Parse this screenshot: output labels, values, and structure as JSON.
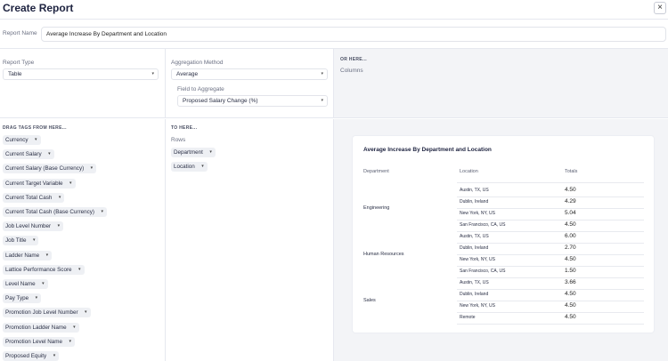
{
  "header": {
    "title": "Create Report",
    "close_icon": "×"
  },
  "report_name": {
    "label": "Report Name",
    "value": "Average Increase By Department and Location"
  },
  "report_type": {
    "label": "Report Type",
    "value": "Table"
  },
  "aggregation": {
    "label": "Aggregation Method",
    "value": "Average",
    "field_label": "Field to Aggregate",
    "field_value": "Proposed Salary Change (%)"
  },
  "or_here": {
    "heading": "OR HERE...",
    "columns_label": "Columns"
  },
  "drag_tags": {
    "heading": "DRAG TAGS FROM HERE...",
    "items": [
      "Currency",
      "Current Salary",
      "Current Salary (Base Currency)",
      "Current Target Variable",
      "Current Total Cash",
      "Current Total Cash (Base Currency)",
      "Job Level Number",
      "Job Title",
      "Ladder Name",
      "Lattice Performance Score",
      "Level Name",
      "Pay Type",
      "Promotion Job Level Number",
      "Promotion Ladder Name",
      "Promotion Level Name",
      "Proposed Equity"
    ]
  },
  "to_here": {
    "heading": "TO HERE...",
    "rows_label": "Rows",
    "rows": [
      "Department",
      "Location"
    ]
  },
  "preview": {
    "title": "Average Increase By Department and Location",
    "headers": [
      "Department",
      "Location",
      "Totals"
    ],
    "groups": [
      {
        "department": "Engineering",
        "rows": [
          {
            "location": "Austin, TX, US",
            "total": "4.50"
          },
          {
            "location": "Dublin, Ireland",
            "total": "4.29"
          },
          {
            "location": "New York, NY, US",
            "total": "5.04"
          },
          {
            "location": "San Francisco, CA, US",
            "total": "4.50"
          }
        ]
      },
      {
        "department": "Human Resources",
        "rows": [
          {
            "location": "Austin, TX, US",
            "total": "6.00"
          },
          {
            "location": "Dublin, Ireland",
            "total": "2.70"
          },
          {
            "location": "New York, NY, US",
            "total": "4.50"
          },
          {
            "location": "San Francisco, CA, US",
            "total": "1.50"
          }
        ]
      },
      {
        "department": "Sales",
        "rows": [
          {
            "location": "Austin, TX, US",
            "total": "3.66"
          },
          {
            "location": "Dublin, Ireland",
            "total": "4.50"
          },
          {
            "location": "New York, NY, US",
            "total": "4.50"
          },
          {
            "location": "Remote",
            "total": "4.50"
          }
        ]
      }
    ]
  },
  "icons": {
    "caret": "▾"
  }
}
